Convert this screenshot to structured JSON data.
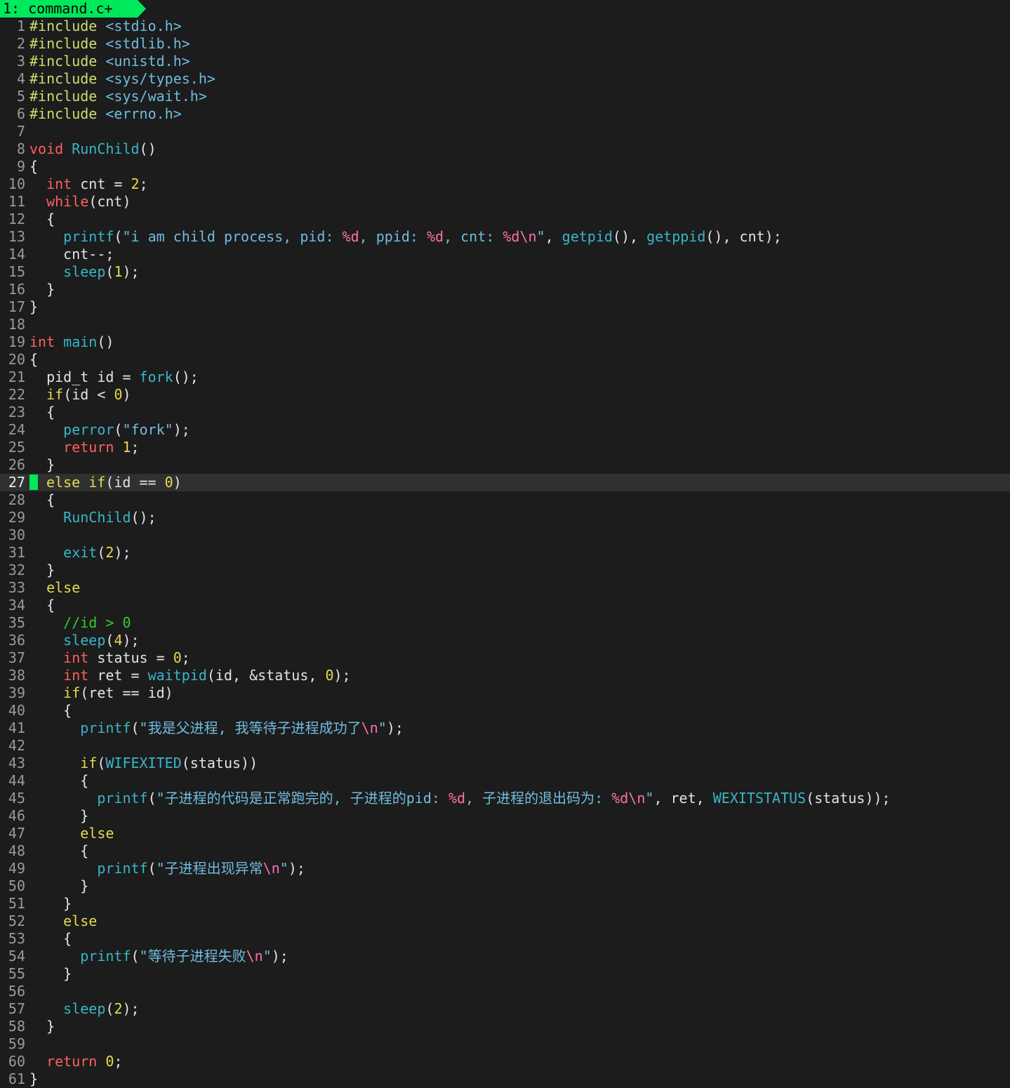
{
  "tabline": {
    "label": "1: command.c+"
  },
  "editor": {
    "cursor_line": 27,
    "lines": [
      [
        [
          "pre",
          "#include "
        ],
        [
          "str",
          "<stdio.h>"
        ]
      ],
      [
        [
          "pre",
          "#include "
        ],
        [
          "str",
          "<stdlib.h>"
        ]
      ],
      [
        [
          "pre",
          "#include "
        ],
        [
          "str",
          "<unistd.h>"
        ]
      ],
      [
        [
          "pre",
          "#include "
        ],
        [
          "str",
          "<sys/types.h>"
        ]
      ],
      [
        [
          "pre",
          "#include "
        ],
        [
          "str",
          "<sys/wait.h>"
        ]
      ],
      [
        [
          "pre",
          "#include "
        ],
        [
          "str",
          "<errno.h>"
        ]
      ],
      [],
      [
        [
          "type",
          "void "
        ],
        [
          "fn",
          "RunChild"
        ],
        [
          "id",
          "()"
        ]
      ],
      [
        [
          "id",
          "{"
        ]
      ],
      [
        [
          "id",
          "  "
        ],
        [
          "type",
          "int"
        ],
        [
          "id",
          " cnt = "
        ],
        [
          "num",
          "2"
        ],
        [
          "id",
          ";"
        ]
      ],
      [
        [
          "id",
          "  "
        ],
        [
          "type",
          "while"
        ],
        [
          "id",
          "(cnt)"
        ]
      ],
      [
        [
          "id",
          "  {"
        ]
      ],
      [
        [
          "id",
          "    "
        ],
        [
          "fn",
          "printf"
        ],
        [
          "id",
          "("
        ],
        [
          "str",
          "\"i am child process, pid: "
        ],
        [
          "esc",
          "%d"
        ],
        [
          "str",
          ", ppid: "
        ],
        [
          "esc",
          "%d"
        ],
        [
          "str",
          ", cnt: "
        ],
        [
          "esc",
          "%d\\n"
        ],
        [
          "str",
          "\""
        ],
        [
          "id",
          ", "
        ],
        [
          "fn",
          "getpid"
        ],
        [
          "id",
          "(), "
        ],
        [
          "fn",
          "getppid"
        ],
        [
          "id",
          "(), cnt);"
        ]
      ],
      [
        [
          "id",
          "    cnt--;"
        ]
      ],
      [
        [
          "id",
          "    "
        ],
        [
          "fn",
          "sleep"
        ],
        [
          "id",
          "("
        ],
        [
          "num",
          "1"
        ],
        [
          "id",
          ");"
        ]
      ],
      [
        [
          "id",
          "  }"
        ]
      ],
      [
        [
          "id",
          "}"
        ]
      ],
      [],
      [
        [
          "type",
          "int "
        ],
        [
          "fn",
          "main"
        ],
        [
          "id",
          "()"
        ]
      ],
      [
        [
          "id",
          "{"
        ]
      ],
      [
        [
          "id",
          "  pid_t id = "
        ],
        [
          "fn",
          "fork"
        ],
        [
          "id",
          "();"
        ]
      ],
      [
        [
          "id",
          "  "
        ],
        [
          "kw",
          "if"
        ],
        [
          "id",
          "(id < "
        ],
        [
          "num",
          "0"
        ],
        [
          "id",
          ")"
        ]
      ],
      [
        [
          "id",
          "  {"
        ]
      ],
      [
        [
          "id",
          "    "
        ],
        [
          "fn",
          "perror"
        ],
        [
          "id",
          "("
        ],
        [
          "str",
          "\"fork\""
        ],
        [
          "id",
          ");"
        ]
      ],
      [
        [
          "id",
          "    "
        ],
        [
          "type",
          "return "
        ],
        [
          "num",
          "1"
        ],
        [
          "id",
          ";"
        ]
      ],
      [
        [
          "id",
          "  }"
        ]
      ],
      [
        [
          "id",
          " "
        ],
        [
          "kw",
          "else if"
        ],
        [
          "id",
          "(id == "
        ],
        [
          "num",
          "0"
        ],
        [
          "id",
          ")"
        ]
      ],
      [
        [
          "id",
          "  {"
        ]
      ],
      [
        [
          "id",
          "    "
        ],
        [
          "fn",
          "RunChild"
        ],
        [
          "id",
          "();"
        ]
      ],
      [],
      [
        [
          "id",
          "    "
        ],
        [
          "fn",
          "exit"
        ],
        [
          "id",
          "("
        ],
        [
          "num",
          "2"
        ],
        [
          "id",
          ");"
        ]
      ],
      [
        [
          "id",
          "  }"
        ]
      ],
      [
        [
          "id",
          "  "
        ],
        [
          "kw",
          "else"
        ]
      ],
      [
        [
          "id",
          "  {"
        ]
      ],
      [
        [
          "id",
          "    "
        ],
        [
          "cmt",
          "//id > 0"
        ]
      ],
      [
        [
          "id",
          "    "
        ],
        [
          "fn",
          "sleep"
        ],
        [
          "id",
          "("
        ],
        [
          "num",
          "4"
        ],
        [
          "id",
          ");"
        ]
      ],
      [
        [
          "id",
          "    "
        ],
        [
          "type",
          "int"
        ],
        [
          "id",
          " status = "
        ],
        [
          "num",
          "0"
        ],
        [
          "id",
          ";"
        ]
      ],
      [
        [
          "id",
          "    "
        ],
        [
          "type",
          "int"
        ],
        [
          "id",
          " ret = "
        ],
        [
          "fn",
          "waitpid"
        ],
        [
          "id",
          "(id, &status, "
        ],
        [
          "num",
          "0"
        ],
        [
          "id",
          ");"
        ]
      ],
      [
        [
          "id",
          "    "
        ],
        [
          "kw",
          "if"
        ],
        [
          "id",
          "(ret == id)"
        ]
      ],
      [
        [
          "id",
          "    {"
        ]
      ],
      [
        [
          "id",
          "      "
        ],
        [
          "fn",
          "printf"
        ],
        [
          "id",
          "("
        ],
        [
          "str",
          "\"我是父进程, 我等待子进程成功了"
        ],
        [
          "esc",
          "\\n"
        ],
        [
          "str",
          "\""
        ],
        [
          "id",
          ");"
        ]
      ],
      [],
      [
        [
          "id",
          "      "
        ],
        [
          "kw",
          "if"
        ],
        [
          "id",
          "("
        ],
        [
          "fn",
          "WIFEXITED"
        ],
        [
          "id",
          "(status))"
        ]
      ],
      [
        [
          "id",
          "      {"
        ]
      ],
      [
        [
          "id",
          "        "
        ],
        [
          "fn",
          "printf"
        ],
        [
          "id",
          "("
        ],
        [
          "str",
          "\"子进程的代码是正常跑完的, 子进程的pid: "
        ],
        [
          "esc",
          "%d"
        ],
        [
          "str",
          ", 子进程的退出码为: "
        ],
        [
          "esc",
          "%d\\n"
        ],
        [
          "str",
          "\""
        ],
        [
          "id",
          ", ret, "
        ],
        [
          "fn",
          "WEXITSTATUS"
        ],
        [
          "id",
          "(status));"
        ]
      ],
      [
        [
          "id",
          "      }"
        ]
      ],
      [
        [
          "id",
          "      "
        ],
        [
          "kw",
          "else"
        ]
      ],
      [
        [
          "id",
          "      {"
        ]
      ],
      [
        [
          "id",
          "        "
        ],
        [
          "fn",
          "printf"
        ],
        [
          "id",
          "("
        ],
        [
          "str",
          "\"子进程出现异常"
        ],
        [
          "esc",
          "\\n"
        ],
        [
          "str",
          "\""
        ],
        [
          "id",
          ");"
        ]
      ],
      [
        [
          "id",
          "      }"
        ]
      ],
      [
        [
          "id",
          "    }"
        ]
      ],
      [
        [
          "id",
          "    "
        ],
        [
          "kw",
          "else"
        ]
      ],
      [
        [
          "id",
          "    {"
        ]
      ],
      [
        [
          "id",
          "      "
        ],
        [
          "fn",
          "printf"
        ],
        [
          "id",
          "("
        ],
        [
          "str",
          "\"等待子进程失败"
        ],
        [
          "esc",
          "\\n"
        ],
        [
          "str",
          "\""
        ],
        [
          "id",
          ");"
        ]
      ],
      [
        [
          "id",
          "    }"
        ]
      ],
      [],
      [
        [
          "id",
          "    "
        ],
        [
          "fn",
          "sleep"
        ],
        [
          "id",
          "("
        ],
        [
          "num",
          "2"
        ],
        [
          "id",
          ");"
        ]
      ],
      [
        [
          "id",
          "  }"
        ]
      ],
      [],
      [
        [
          "id",
          "  "
        ],
        [
          "type",
          "return "
        ],
        [
          "num",
          "0"
        ],
        [
          "id",
          ";"
        ]
      ],
      [
        [
          "id",
          "}"
        ]
      ]
    ]
  }
}
